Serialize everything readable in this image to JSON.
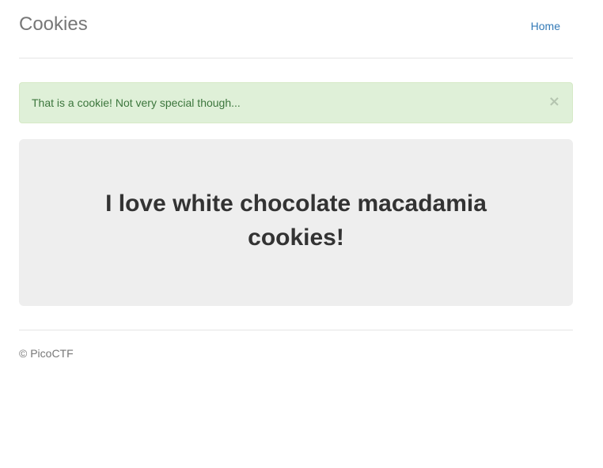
{
  "header": {
    "brand": "Cookies",
    "nav": {
      "home_label": "Home"
    }
  },
  "alert": {
    "message": "That is a cookie! Not very special though...",
    "close_symbol": "×",
    "color": "#3c763d",
    "background": "#dff0d8"
  },
  "jumbotron": {
    "heading": "I love white chocolate macadamia cookies!"
  },
  "footer": {
    "text": "© PicoCTF"
  },
  "colors": {
    "link": "#337ab7",
    "brand": "#777777"
  }
}
